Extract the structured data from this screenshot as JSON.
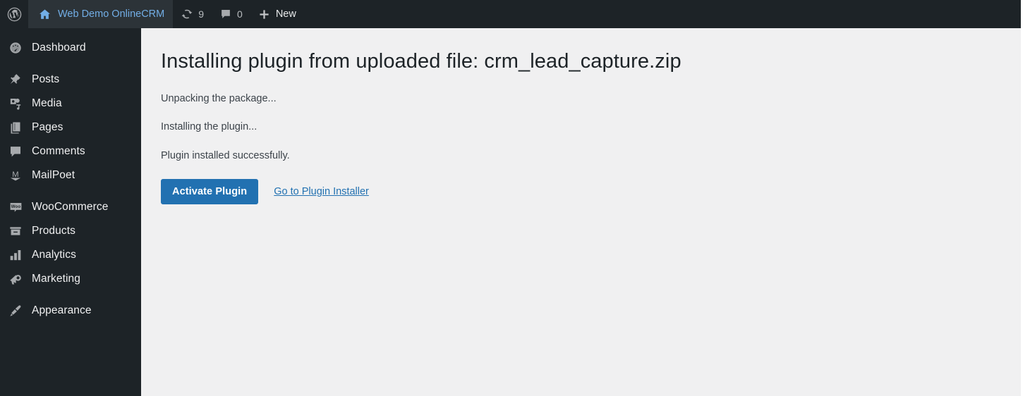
{
  "adminbar": {
    "logo_icon": "wordpress-logo-icon",
    "site": {
      "icon": "home-icon",
      "label": "Web Demo OnlineCRM"
    },
    "updates": {
      "icon": "update-arrows-icon",
      "count": "9"
    },
    "comments": {
      "icon": "comment-bubble-icon",
      "count": "0"
    },
    "new": {
      "icon": "plus-icon",
      "label": "New"
    }
  },
  "sidebar": {
    "items": [
      {
        "label": "Dashboard",
        "icon": "dashboard-gauge-icon",
        "separator_after": true
      },
      {
        "label": "Posts",
        "icon": "pin-icon",
        "separator_after": false
      },
      {
        "label": "Media",
        "icon": "media-icon",
        "separator_after": false
      },
      {
        "label": "Pages",
        "icon": "pages-icon",
        "separator_after": false
      },
      {
        "label": "Comments",
        "icon": "comment-bubble-icon",
        "separator_after": false
      },
      {
        "label": "MailPoet",
        "icon": "mailpoet-icon",
        "separator_after": true
      },
      {
        "label": "WooCommerce",
        "icon": "woocommerce-icon",
        "separator_after": false
      },
      {
        "label": "Products",
        "icon": "products-box-icon",
        "separator_after": false
      },
      {
        "label": "Analytics",
        "icon": "analytics-bars-icon",
        "separator_after": false
      },
      {
        "label": "Marketing",
        "icon": "megaphone-icon",
        "separator_after": true
      },
      {
        "label": "Appearance",
        "icon": "paintbrush-icon",
        "separator_after": false
      }
    ]
  },
  "main": {
    "title": "Installing plugin from uploaded file: crm_lead_capture.zip",
    "status_lines": [
      "Unpacking the package...",
      "Installing the plugin...",
      "Plugin installed successfully."
    ],
    "activate_button_label": "Activate Plugin",
    "installer_link_label": "Go to Plugin Installer"
  },
  "colors": {
    "admin_chrome": "#1d2327",
    "admin_site_highlight": "#2c3338",
    "accent_blue": "#2271b1",
    "link_blue": "#2271b1",
    "site_title_blue": "#72aee6",
    "content_bg": "#f0f0f1",
    "body_text": "#3c434a"
  }
}
